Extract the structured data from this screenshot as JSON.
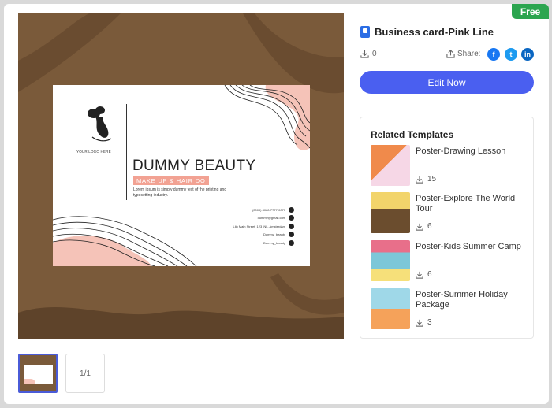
{
  "badge": "Free",
  "template": {
    "title": "Business card-Pink Line",
    "downloads": "0",
    "share_label": "Share:",
    "edit_label": "Edit Now",
    "page_indicator": "1/1"
  },
  "card": {
    "logo_text": "YOUR LOGO HERE",
    "brand": "DUMMY BEAUTY",
    "tagline": "MAKE UP & HAIR DO",
    "description": "Lorem ipsum is simply dummy text of the printing and typesetting industry.",
    "contacts": [
      {
        "text": "(0000) 8080-7777-0077",
        "icon": "phone-icon"
      },
      {
        "text": "dummy@gmail.com",
        "icon": "mail-icon"
      },
      {
        "text": "Lilo Main Street, 123 ,NL, Amsterdam",
        "icon": "location-icon"
      },
      {
        "text": "Dummy_beauty",
        "icon": "instagram-icon"
      },
      {
        "text": "Dummy_beauty",
        "icon": "facebook-icon"
      }
    ]
  },
  "related": {
    "heading": "Related Templates",
    "items": [
      {
        "name": "Poster-Drawing Lesson",
        "downloads": "15",
        "colors": [
          "#f08a4b",
          "#f6d7e6"
        ]
      },
      {
        "name": "Poster-Explore The World Tour",
        "downloads": "6",
        "colors": [
          "#6b4d2e",
          "#f2d46b"
        ]
      },
      {
        "name": "Poster-Kids Summer Camp",
        "downloads": "6",
        "colors": [
          "#e86f8a",
          "#7cc7d8"
        ]
      },
      {
        "name": "Poster-Summer Holiday Package",
        "downloads": "3",
        "colors": [
          "#9fd8e8",
          "#f5a25a"
        ]
      }
    ]
  },
  "colors": {
    "accent": "#4a5ff0",
    "badge": "#2ca54f",
    "preview_bg": "#7a5a3a",
    "card_pink": "#f2a293"
  }
}
